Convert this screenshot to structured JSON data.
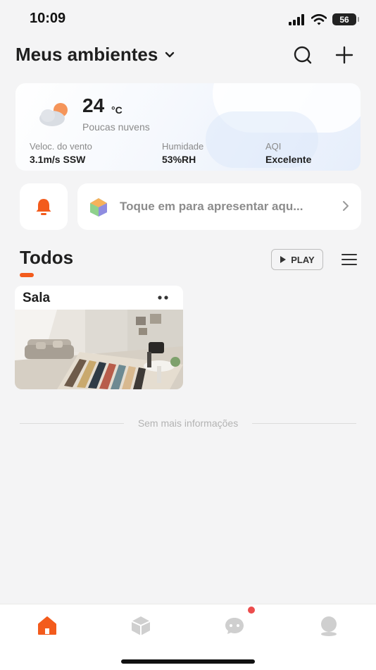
{
  "status_bar": {
    "time": "10:09",
    "battery": "56"
  },
  "header": {
    "title": "Meus ambientes"
  },
  "weather": {
    "temperature": "24",
    "unit": "°C",
    "description": "Poucas nuvens",
    "wind_label": "Veloc. do vento",
    "wind_value": "3.1m/s SSW",
    "humidity_label": "Humidade",
    "humidity_value": "53%RH",
    "aqi_label": "AQI",
    "aqi_value": "Excelente"
  },
  "tip": {
    "text": "Toque em para apresentar aqu..."
  },
  "section": {
    "title": "Todos",
    "play_label": "PLAY"
  },
  "rooms": [
    {
      "name": "Sala"
    }
  ],
  "footer_text": "Sem mais informações",
  "tabs": [
    {
      "name": "home",
      "active": true
    },
    {
      "name": "smart",
      "active": false
    },
    {
      "name": "messages",
      "active": false,
      "badge": true
    },
    {
      "name": "profile",
      "active": false
    }
  ],
  "colors": {
    "accent": "#f35b1c",
    "badge": "#ec4c4c",
    "background": "#f4f4f5"
  }
}
